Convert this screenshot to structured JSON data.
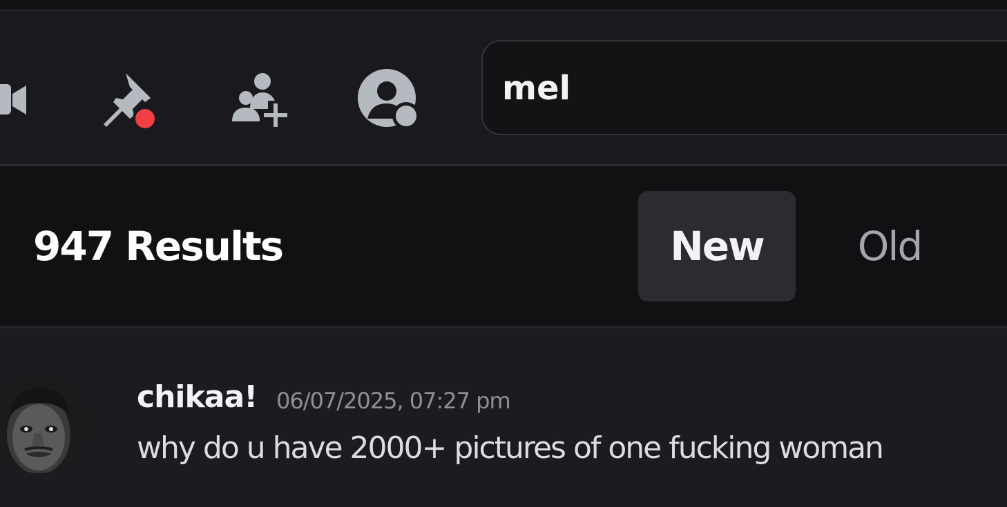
{
  "toolbar": {
    "icons": [
      {
        "name": "video-camera-icon",
        "color": "#b5bac1"
      },
      {
        "name": "pinned-messages-icon",
        "color": "#b5bac1",
        "badge_color": "#f23f43"
      },
      {
        "name": "add-friends-to-dm-icon",
        "color": "#b5bac1"
      },
      {
        "name": "user-profile-icon",
        "color": "#b5bac1"
      }
    ],
    "search": {
      "value": "mel",
      "placeholder": "Search"
    }
  },
  "results": {
    "count_label": "947 Results",
    "sort_tabs": [
      {
        "label": "New",
        "selected": true
      },
      {
        "label": "Old",
        "selected": false
      }
    ]
  },
  "messages": [
    {
      "author": "chikaa!",
      "timestamp": "06/07/2025, 07:27 pm",
      "content": "why do u have 2000+ pictures of one fucking woman"
    }
  ],
  "colors": {
    "background": "#1a1a1e",
    "header_background": "#111113",
    "selected_tab": "#2b2b30",
    "text_primary": "#f2f3f5",
    "text_muted": "#8e9099",
    "badge_red": "#f23f43"
  }
}
